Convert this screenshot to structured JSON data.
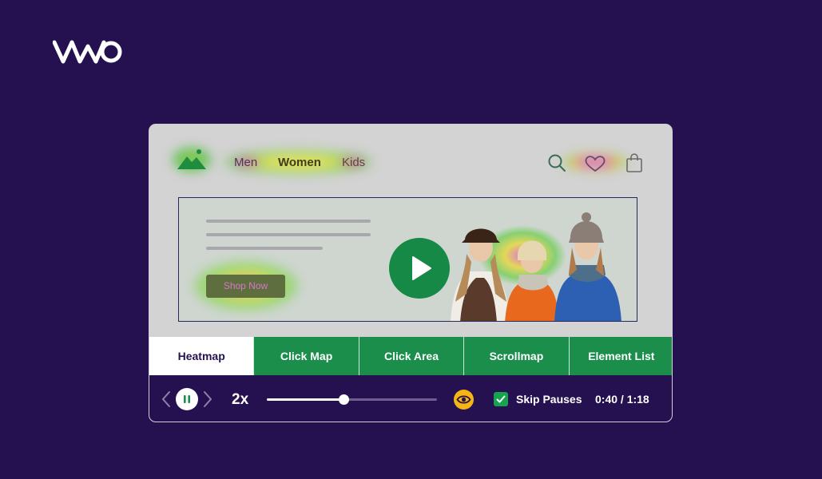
{
  "brand": {
    "logo_text": "VWO"
  },
  "site": {
    "nav": [
      {
        "label": "Men"
      },
      {
        "label": "Women"
      },
      {
        "label": "Kids"
      }
    ],
    "icons": [
      "search-icon",
      "heart-icon",
      "shopping-bag-icon"
    ],
    "hero": {
      "cta_label": "Shop Now"
    }
  },
  "tabs": [
    {
      "label": "Heatmap",
      "active": true
    },
    {
      "label": "Click Map",
      "active": false
    },
    {
      "label": "Click Area",
      "active": false
    },
    {
      "label": "Scrollmap",
      "active": false
    },
    {
      "label": "Element List",
      "active": false
    }
  ],
  "player": {
    "speed": "2x",
    "progress": 0.45,
    "skip_pauses_label": "Skip Pauses",
    "skip_pauses_checked": true,
    "time": "0:40 / 1:18"
  },
  "colors": {
    "background": "#261150",
    "accent_green": "#1c8e4c",
    "eye_yellow": "#f5b614",
    "frame_gray": "#d3d3d3"
  }
}
